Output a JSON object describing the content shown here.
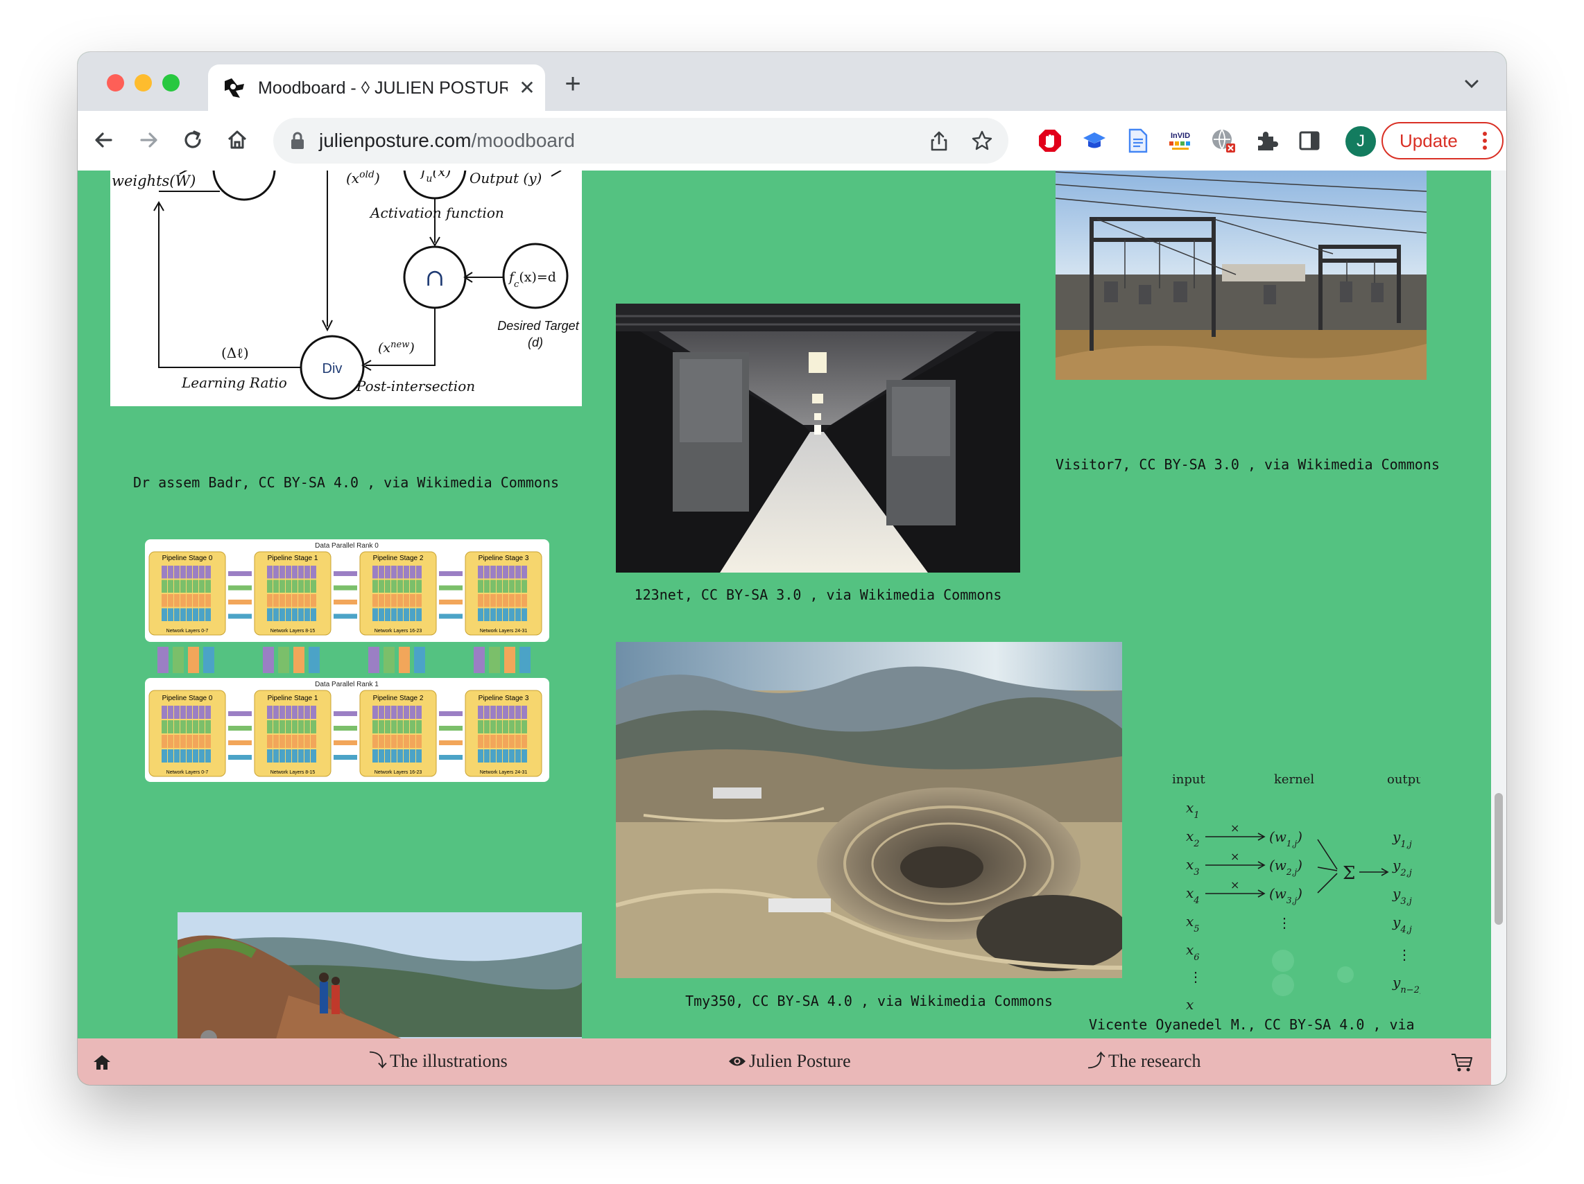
{
  "browser": {
    "tab_title": "Moodboard - ◊ JULIEN POSTURE",
    "url_host": "julienposture.com",
    "url_path": "/moodboard",
    "update_label": "Update",
    "avatar_letter": "J",
    "extensions": [
      "adblock-icon",
      "graduation-cap-icon",
      "docs-icon",
      "invid-icon",
      "globe-blocked-icon",
      "puzzle-icon",
      "sidepanel-icon"
    ]
  },
  "moodboard": {
    "diagram_labels": {
      "weights": "weights(W)",
      "x_old": "(x",
      "x_old_sup": "old",
      "fu": "f",
      "fu_sub": "u",
      "fu_arg": "(x)",
      "output": "Output (y)",
      "activation": "Activation function",
      "intersection": "∩",
      "fc": "f",
      "fc_sub": "c",
      "fc_arg": "(x)=d",
      "desired": "Desired Target",
      "desired_d": "(d)",
      "delta": "(Δℓ)",
      "div": "Div",
      "x_new": "(x",
      "x_new_sup": "new",
      "learning": "Learning Ratio",
      "post": "Post-intersection",
      "sigma": "Σ"
    },
    "caption_1": "Dr assem Badr, CC BY-SA 4.0 , via Wikimedia Commons",
    "caption_2": "123net, CC BY-SA 3.0 , via Wikimedia Commons",
    "caption_3": "Visitor7, CC BY-SA 3.0 , via Wikimedia Commons",
    "caption_4": "Tmy350, CC BY-SA 4.0 , via Wikimedia Commons",
    "caption_5": "Vicente Oyanedel M., CC BY-SA 4.0 , via",
    "pipeline": {
      "rank0": "Data Parallel Rank 0",
      "rank1": "Data Parallel Rank 1",
      "stages": [
        "Pipeline Stage 0",
        "Pipeline Stage 1",
        "Pipeline Stage 2",
        "Pipeline Stage 3"
      ],
      "layers": [
        "Network Layers 0-7",
        "Network Layers 8-15",
        "Network Layers 16-23",
        "Network Layers 24-31"
      ]
    },
    "conv": {
      "input": "input",
      "kernel": "kernel",
      "output": "output"
    }
  },
  "footer": {
    "illustrations": "The illustrations",
    "julien": "Julien Posture",
    "research": "The research"
  }
}
